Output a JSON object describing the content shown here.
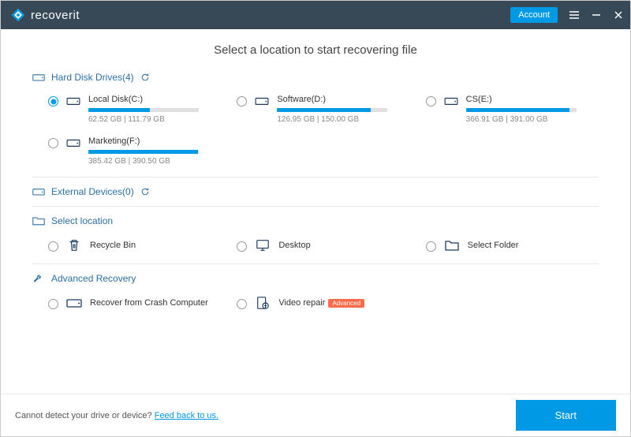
{
  "app": {
    "name": "recoverit"
  },
  "titlebar": {
    "account_label": "Account"
  },
  "page": {
    "title": "Select a location to start recovering file"
  },
  "sections": {
    "drives_label": "Hard Disk Drives(4)",
    "external_label": "External Devices(0)",
    "select_location_label": "Select location",
    "advanced_label": "Advanced Recovery"
  },
  "drives": [
    {
      "name": "Local Disk(C:)",
      "used_gb": 62.52,
      "total_gb": 111.79,
      "size_text": "62.52  GB | 111.79  GB",
      "pct": 56,
      "selected": true
    },
    {
      "name": "Software(D:)",
      "used_gb": 126.95,
      "total_gb": 150.0,
      "size_text": "126.95  GB | 150.00  GB",
      "pct": 85,
      "selected": false
    },
    {
      "name": "CS(E:)",
      "used_gb": 366.91,
      "total_gb": 391.0,
      "size_text": "366.91  GB | 391.00  GB",
      "pct": 94,
      "selected": false
    },
    {
      "name": "Marketing(F:)",
      "used_gb": 385.42,
      "total_gb": 390.5,
      "size_text": "385.42  GB | 390.50  GB",
      "pct": 99,
      "selected": false
    }
  ],
  "locations": {
    "recycle_bin": "Recycle Bin",
    "desktop": "Desktop",
    "select_folder": "Select Folder"
  },
  "advanced": {
    "crash": "Recover from Crash Computer",
    "video_repair": "Video repair",
    "video_badge": "Advanced"
  },
  "footer": {
    "text": "Cannot detect your drive or device? ",
    "link": "Feed back to us.",
    "start_label": "Start"
  },
  "colors": {
    "accent": "#0099e5",
    "header": "#374856",
    "badge": "#ff6b4a"
  }
}
